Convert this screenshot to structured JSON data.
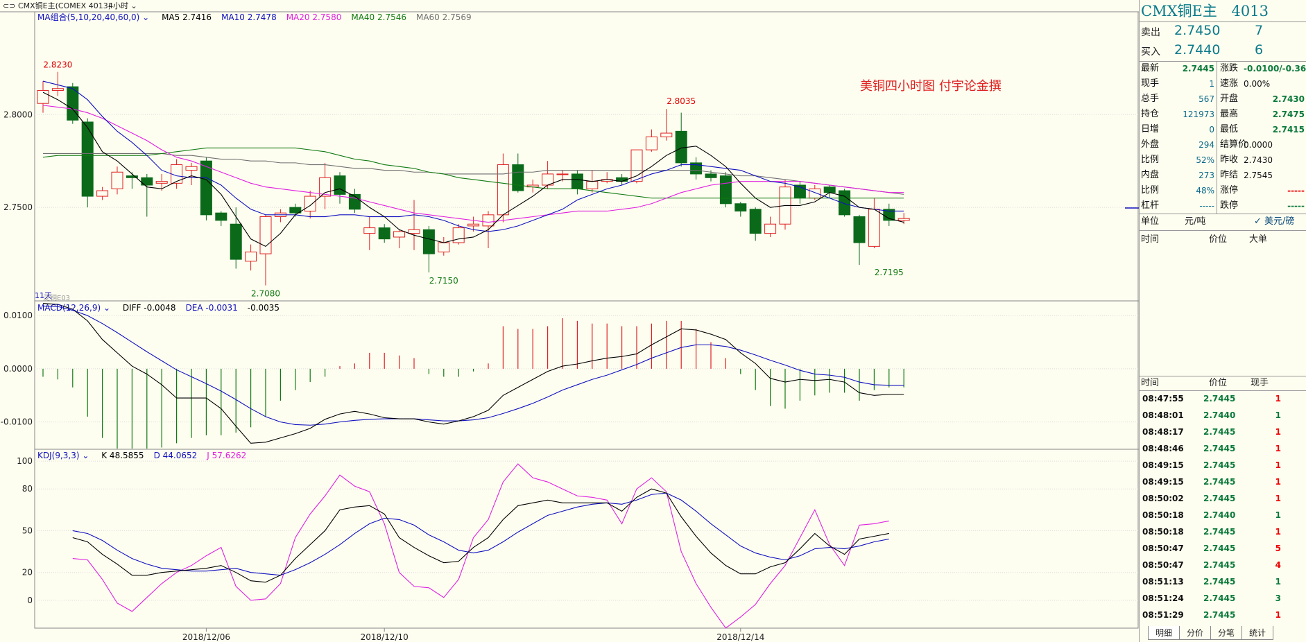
{
  "window": {
    "title": "CMX铜E主(COMEX 4013)",
    "period": "4小时"
  },
  "main_indicator": {
    "name": "MA组合(5,10,20,40,60,0)",
    "values": [
      {
        "label": "MA5 2.7416",
        "color": "#000000"
      },
      {
        "label": "MA10 2.7478",
        "color": "#1010c0"
      },
      {
        "label": "MA20 2.7580",
        "color": "#e020e0"
      },
      {
        "label": "MA40 2.7546",
        "color": "#107a10"
      },
      {
        "label": "MA60 2.7569",
        "color": "#707070"
      }
    ]
  },
  "annotation": "美铜四小时图  付宇论金撰",
  "sub_caption": "11天",
  "watermark": "泛铜E03",
  "macd_indicator": {
    "name": "MACD(12,26,9)",
    "values": [
      {
        "label": "DIFF -0.0048",
        "color": "#000000"
      },
      {
        "label": "DEA -0.0031",
        "color": "#1010c0"
      },
      {
        "label": "-0.0035",
        "color": "#000000"
      }
    ]
  },
  "kdj_indicator": {
    "name": "KDJ(9,3,3)",
    "values": [
      {
        "label": "K 48.5855",
        "color": "#000000"
      },
      {
        "label": "D 44.0652",
        "color": "#1010c0"
      },
      {
        "label": "J 57.6262",
        "color": "#e020e0"
      }
    ]
  },
  "chart_data": {
    "type": "candlestick",
    "price_axis": {
      "ticks": [
        "2.8000",
        "2.7500"
      ],
      "range": [
        2.7,
        2.855
      ]
    },
    "macd_axis": {
      "ticks": [
        "0.0100",
        "0.0000",
        "-0.0100"
      ],
      "range": [
        -0.015,
        0.0125
      ]
    },
    "kdj_axis": {
      "ticks": [
        "100",
        "80",
        "50",
        "20",
        "0"
      ],
      "range": [
        -20,
        108
      ]
    },
    "date_labels": [
      {
        "index": 11,
        "label": "2018/12/06"
      },
      {
        "index": 23,
        "label": "2018/12/10"
      },
      {
        "index": 47,
        "label": "2018/12/14"
      }
    ],
    "price_labels": [
      {
        "index": 1,
        "value": 2.823,
        "label": "2.8230",
        "color": "#e00000"
      },
      {
        "index": 15,
        "value": 2.708,
        "label": "2.7080",
        "color": "#107a10"
      },
      {
        "index": 27,
        "value": 2.715,
        "label": "2.7150",
        "color": "#107a10"
      },
      {
        "index": 43,
        "value": 2.8035,
        "label": "2.8035",
        "color": "#e00000"
      },
      {
        "index": 57,
        "value": 2.7195,
        "label": "2.7195",
        "color": "#107a10"
      }
    ],
    "candles": [
      [
        2.806,
        2.813,
        2.801,
        2.818
      ],
      [
        2.813,
        2.814,
        2.81,
        2.823
      ],
      [
        2.815,
        2.797,
        2.795,
        2.817
      ],
      [
        2.796,
        2.756,
        2.75,
        2.798
      ],
      [
        2.756,
        2.759,
        2.754,
        2.761
      ],
      [
        2.76,
        2.769,
        2.757,
        2.772
      ],
      [
        2.767,
        2.766,
        2.76,
        2.769
      ],
      [
        2.766,
        2.762,
        2.745,
        2.768
      ],
      [
        2.763,
        2.764,
        2.759,
        2.768
      ],
      [
        2.763,
        2.773,
        2.76,
        2.776
      ],
      [
        2.77,
        2.772,
        2.762,
        2.774
      ],
      [
        2.775,
        2.746,
        2.743,
        2.777
      ],
      [
        2.747,
        2.743,
        2.74,
        2.748
      ],
      [
        2.741,
        2.722,
        2.717,
        2.75
      ],
      [
        2.721,
        2.726,
        2.716,
        2.73
      ],
      [
        2.725,
        2.745,
        2.708,
        2.746
      ],
      [
        2.745,
        2.747,
        2.742,
        2.749
      ],
      [
        2.75,
        2.747,
        2.745,
        2.752
      ],
      [
        2.748,
        2.756,
        2.744,
        2.759
      ],
      [
        2.756,
        2.766,
        2.749,
        2.774
      ],
      [
        2.767,
        2.757,
        2.752,
        2.769
      ],
      [
        2.757,
        2.749,
        2.747,
        2.76
      ],
      [
        2.736,
        2.739,
        2.727,
        2.745
      ],
      [
        2.739,
        2.733,
        2.731,
        2.741
      ],
      [
        2.734,
        2.737,
        2.728,
        2.738
      ],
      [
        2.736,
        2.738,
        2.727,
        2.754
      ],
      [
        2.738,
        2.725,
        2.715,
        2.74
      ],
      [
        2.726,
        2.731,
        2.724,
        2.734
      ],
      [
        2.731,
        2.739,
        2.73,
        2.741
      ],
      [
        2.74,
        2.741,
        2.737,
        2.745
      ],
      [
        2.74,
        2.746,
        2.728,
        2.748
      ],
      [
        2.746,
        2.773,
        2.742,
        2.779
      ],
      [
        2.773,
        2.759,
        2.758,
        2.779
      ],
      [
        2.761,
        2.762,
        2.758,
        2.765
      ],
      [
        2.762,
        2.768,
        2.76,
        2.775
      ],
      [
        2.768,
        2.768,
        2.764,
        2.77
      ],
      [
        2.768,
        2.76,
        2.757,
        2.77
      ],
      [
        2.76,
        2.764,
        2.758,
        2.77
      ],
      [
        2.764,
        2.765,
        2.763,
        2.769
      ],
      [
        2.766,
        2.764,
        2.762,
        2.768
      ],
      [
        2.764,
        2.781,
        2.763,
        2.781
      ],
      [
        2.781,
        2.788,
        2.78,
        2.792
      ],
      [
        2.788,
        2.79,
        2.786,
        2.803
      ],
      [
        2.791,
        2.774,
        2.772,
        2.801
      ],
      [
        2.774,
        2.768,
        2.765,
        2.777
      ],
      [
        2.768,
        2.766,
        2.764,
        2.77
      ],
      [
        2.767,
        2.752,
        2.75,
        2.769
      ],
      [
        2.752,
        2.748,
        2.745,
        2.753
      ],
      [
        2.749,
        2.736,
        2.732,
        2.75
      ],
      [
        2.736,
        2.741,
        2.734,
        2.745
      ],
      [
        2.741,
        2.761,
        2.738,
        2.765
      ],
      [
        2.762,
        2.755,
        2.752,
        2.764
      ],
      [
        2.755,
        2.76,
        2.754,
        2.762
      ],
      [
        2.761,
        2.758,
        2.755,
        2.762
      ],
      [
        2.759,
        2.746,
        2.745,
        2.76
      ],
      [
        2.745,
        2.731,
        2.719,
        2.746
      ],
      [
        2.729,
        2.749,
        2.728,
        2.755
      ],
      [
        2.749,
        2.743,
        2.74,
        2.752
      ],
      [
        2.743,
        2.744,
        2.741,
        2.747
      ]
    ],
    "ma5": [
      2.812,
      2.808,
      2.803,
      2.793,
      2.78,
      2.775,
      2.768,
      2.761,
      2.76,
      2.764,
      2.767,
      2.765,
      2.757,
      2.745,
      2.733,
      2.729,
      2.736,
      2.746,
      2.751,
      2.758,
      2.76,
      2.756,
      2.75,
      2.745,
      2.738,
      2.735,
      2.733,
      2.731,
      2.733,
      2.734,
      2.738,
      2.746,
      2.751,
      2.756,
      2.762,
      2.765,
      2.765,
      2.764,
      2.765,
      2.764,
      2.767,
      2.772,
      2.778,
      2.782,
      2.783,
      2.778,
      2.772,
      2.763,
      2.755,
      2.75,
      2.751,
      2.751,
      2.753,
      2.758,
      2.756,
      2.75,
      2.749,
      2.744,
      2.742
    ],
    "ma10": [
      2.818,
      2.816,
      2.814,
      2.808,
      2.799,
      2.791,
      2.785,
      2.778,
      2.77,
      2.767,
      2.766,
      2.766,
      2.762,
      2.755,
      2.749,
      2.746,
      2.746,
      2.746,
      2.745,
      2.745,
      2.746,
      2.746,
      2.745,
      2.745,
      2.745,
      2.746,
      2.745,
      2.743,
      2.74,
      2.738,
      2.737,
      2.738,
      2.74,
      2.743,
      2.746,
      2.749,
      2.754,
      2.757,
      2.76,
      2.762,
      2.765,
      2.768,
      2.77,
      2.773,
      2.773,
      2.772,
      2.771,
      2.77,
      2.767,
      2.764,
      2.763,
      2.761,
      2.758,
      2.755,
      2.752,
      2.75,
      2.749,
      2.748,
      2.748
    ],
    "ma20": [
      2.805,
      2.804,
      2.803,
      2.801,
      2.798,
      2.794,
      2.79,
      2.786,
      2.781,
      2.777,
      2.775,
      2.772,
      2.769,
      2.766,
      2.763,
      2.761,
      2.76,
      2.759,
      2.758,
      2.757,
      2.756,
      2.755,
      2.753,
      2.751,
      2.749,
      2.747,
      2.746,
      2.745,
      2.744,
      2.743,
      2.742,
      2.743,
      2.744,
      2.745,
      2.746,
      2.747,
      2.748,
      2.748,
      2.748,
      2.749,
      2.75,
      2.752,
      2.755,
      2.758,
      2.76,
      2.762,
      2.763,
      2.764,
      2.764,
      2.764,
      2.764,
      2.764,
      2.763,
      2.762,
      2.761,
      2.76,
      2.759,
      2.758,
      2.758
    ],
    "ma40": [
      2.777,
      2.778,
      2.778,
      2.778,
      2.778,
      2.778,
      2.778,
      2.778,
      2.779,
      2.78,
      2.781,
      2.782,
      2.782,
      2.782,
      2.782,
      2.782,
      2.782,
      2.782,
      2.781,
      2.78,
      2.778,
      2.776,
      2.775,
      2.773,
      2.772,
      2.771,
      2.769,
      2.768,
      2.766,
      2.765,
      2.764,
      2.763,
      2.762,
      2.761,
      2.76,
      2.76,
      2.76,
      2.759,
      2.758,
      2.757,
      2.756,
      2.755,
      2.755,
      2.755,
      2.755,
      2.755,
      2.755,
      2.755,
      2.755,
      2.755,
      2.755,
      2.755,
      2.755,
      2.755,
      2.755,
      2.755,
      2.755,
      2.755,
      2.755
    ],
    "ma60": [
      2.779,
      2.779,
      2.779,
      2.779,
      2.779,
      2.779,
      2.779,
      2.779,
      2.779,
      2.778,
      2.778,
      2.777,
      2.776,
      2.776,
      2.775,
      2.775,
      2.774,
      2.774,
      2.773,
      2.773,
      2.772,
      2.771,
      2.771,
      2.77,
      2.77,
      2.769,
      2.769,
      2.768,
      2.768,
      2.768,
      2.768,
      2.768,
      2.769,
      2.769,
      2.77,
      2.77,
      2.77,
      2.77,
      2.77,
      2.77,
      2.77,
      2.77,
      2.77,
      2.77,
      2.77,
      2.769,
      2.768,
      2.767,
      2.767,
      2.766,
      2.765,
      2.764,
      2.763,
      2.762,
      2.761,
      2.76,
      2.759,
      2.758,
      2.757
    ],
    "macd_hist": [
      -0.0015,
      -0.002,
      -0.0035,
      -0.009,
      -0.013,
      -0.015,
      -0.015,
      -0.015,
      -0.0148,
      -0.014,
      -0.013,
      -0.0125,
      -0.0125,
      -0.012,
      -0.011,
      -0.009,
      -0.006,
      -0.004,
      -0.0025,
      -0.0015,
      0.0005,
      0.001,
      0.003,
      0.003,
      0.0025,
      0.002,
      -0.001,
      -0.0015,
      -0.0015,
      -0.0005,
      0.001,
      0.008,
      0.0075,
      0.0075,
      0.008,
      0.0095,
      0.009,
      0.0085,
      0.0085,
      0.008,
      0.008,
      0.0085,
      0.009,
      0.009,
      0.0075,
      0.005,
      0.002,
      -0.001,
      -0.004,
      -0.007,
      -0.0075,
      -0.006,
      -0.005,
      -0.0045,
      -0.0045,
      -0.006,
      -0.004,
      -0.0035,
      -0.0035
    ],
    "macd_diff": [
      0.0123,
      0.0121,
      0.0112,
      0.009,
      0.0055,
      0.003,
      0.0005,
      -0.001,
      -0.003,
      -0.0055,
      -0.0055,
      -0.0055,
      -0.0075,
      -0.0108,
      -0.014,
      -0.0138,
      -0.013,
      -0.0122,
      -0.0112,
      -0.0095,
      -0.0085,
      -0.008,
      -0.0085,
      -0.0092,
      -0.0094,
      -0.0094,
      -0.01,
      -0.0104,
      -0.0098,
      -0.009,
      -0.0078,
      -0.005,
      -0.0035,
      -0.002,
      -0.0005,
      0.0005,
      0.0009,
      0.0015,
      0.002,
      0.0023,
      0.0028,
      0.0045,
      0.006,
      0.0075,
      0.0073,
      0.0065,
      0.0055,
      0.003,
      0.001,
      -0.0018,
      -0.0025,
      -0.002,
      -0.0022,
      -0.002,
      -0.0025,
      -0.0045,
      -0.005,
      -0.0048,
      -0.0048
    ],
    "macd_dea": [
      0.0118,
      0.0117,
      0.011,
      0.01,
      0.0085,
      0.0068,
      0.005,
      0.0032,
      0.0015,
      -0.0002,
      -0.0015,
      -0.0028,
      -0.0042,
      -0.0058,
      -0.0075,
      -0.009,
      -0.01,
      -0.0105,
      -0.0106,
      -0.0104,
      -0.01,
      -0.0097,
      -0.0095,
      -0.0094,
      -0.0094,
      -0.0094,
      -0.0096,
      -0.0098,
      -0.0098,
      -0.0096,
      -0.0092,
      -0.0084,
      -0.0075,
      -0.0065,
      -0.0053,
      -0.004,
      -0.003,
      -0.002,
      -0.0012,
      -0.0002,
      0.0008,
      0.002,
      0.003,
      0.004,
      0.0045,
      0.0045,
      0.0042,
      0.0035,
      0.0026,
      0.0016,
      0.0007,
      -0.0003,
      -0.001,
      -0.0012,
      -0.0016,
      -0.0025,
      -0.003,
      -0.0031,
      -0.0031
    ],
    "kdj_k": [
      45,
      42,
      33,
      26,
      18,
      18,
      20,
      21,
      22,
      23,
      25,
      20,
      14,
      13,
      18,
      30,
      40,
      50,
      65,
      67,
      68,
      62,
      45,
      38,
      32,
      27,
      28,
      38,
      45,
      58,
      68,
      70,
      72,
      70,
      70,
      70,
      70,
      64,
      74,
      80,
      77,
      60,
      46,
      34,
      25,
      19,
      19,
      24,
      27,
      37,
      48,
      39,
      33,
      44,
      46,
      48
    ],
    "kdj_d": [
      50,
      48,
      43,
      36,
      30,
      26,
      23,
      22,
      21,
      21,
      22,
      23,
      20,
      19,
      18,
      22,
      27,
      33,
      40,
      48,
      55,
      59,
      58,
      54,
      47,
      42,
      36,
      34,
      36,
      42,
      49,
      55,
      61,
      64,
      67,
      69,
      70,
      69,
      72,
      76,
      77,
      72,
      64,
      55,
      47,
      39,
      34,
      31,
      29,
      32,
      37,
      38,
      37,
      39,
      42,
      44
    ],
    "kdj_j": [
      30,
      29,
      15,
      -2,
      -8,
      2,
      12,
      20,
      25,
      32,
      38,
      10,
      0,
      1,
      12,
      45,
      62,
      75,
      90,
      82,
      78,
      55,
      20,
      10,
      9,
      2,
      15,
      45,
      58,
      85,
      98,
      88,
      85,
      80,
      75,
      74,
      72,
      55,
      80,
      88,
      78,
      35,
      12,
      -5,
      -20,
      -12,
      -3,
      12,
      25,
      45,
      65,
      40,
      25,
      54,
      55,
      57
    ]
  },
  "panel": {
    "title": "CMX铜E主",
    "code": "4013",
    "quote": {
      "sell_label": "卖出",
      "sell_price": "2.7450",
      "sell_vol": "7",
      "buy_label": "买入",
      "buy_price": "2.7440",
      "buy_vol": "6"
    },
    "stats_left": [
      {
        "label": "最新",
        "value": "2.7445",
        "cls": "g"
      },
      {
        "label": "现手",
        "value": "1",
        "cls": "b"
      },
      {
        "label": "总手",
        "value": "567",
        "cls": "b"
      },
      {
        "label": "持仓",
        "value": "121973",
        "cls": "b"
      },
      {
        "label": "日增",
        "value": "0",
        "cls": "b"
      },
      {
        "label": "外盘",
        "value": "294",
        "cls": "b"
      },
      {
        "label": "比例",
        "value": "52%",
        "cls": "b"
      },
      {
        "label": "内盘",
        "value": "273",
        "cls": "b"
      },
      {
        "label": "比例",
        "value": "48%",
        "cls": "b"
      },
      {
        "label": "杠杆",
        "value": "-----",
        "cls": "b"
      }
    ],
    "stats_right": [
      {
        "label": "涨跌",
        "value": "-0.0100/-0.36%",
        "cls": "g"
      },
      {
        "label": "速涨",
        "value": "0.00%",
        "cls": "k"
      },
      {
        "label": "开盘",
        "value": "2.7430",
        "cls": "g"
      },
      {
        "label": "最高",
        "value": "2.7475",
        "cls": "g"
      },
      {
        "label": "最低",
        "value": "2.7415",
        "cls": "g"
      },
      {
        "label": "结算价",
        "value": "0.0000",
        "cls": "k"
      },
      {
        "label": "昨收",
        "value": "2.7430",
        "cls": "k"
      },
      {
        "label": "昨结",
        "value": "2.7545",
        "cls": "k"
      },
      {
        "label": "涨停",
        "value": "-----",
        "cls": "r"
      },
      {
        "label": "跌停",
        "value": "-----",
        "cls": "g"
      }
    ],
    "unit_label": "单位",
    "unit_value": "元/吨",
    "currency": "✓ 美元/磅",
    "big_headers": [
      "时间",
      "价位",
      "大单"
    ],
    "tick_headers": [
      "时间",
      "价位",
      "现手"
    ],
    "ticks": [
      {
        "time": "08:47:55",
        "price": "2.7445",
        "vol": "1",
        "vc": "r"
      },
      {
        "time": "08:48:01",
        "price": "2.7440",
        "vol": "1",
        "vc": "g"
      },
      {
        "time": "08:48:17",
        "price": "2.7445",
        "vol": "1",
        "vc": "r"
      },
      {
        "time": "08:48:46",
        "price": "2.7445",
        "vol": "1",
        "vc": "r"
      },
      {
        "time": "08:49:15",
        "price": "2.7445",
        "vol": "1",
        "vc": "r"
      },
      {
        "time": "08:49:15",
        "price": "2.7445",
        "vol": "1",
        "vc": "r"
      },
      {
        "time": "08:50:02",
        "price": "2.7445",
        "vol": "1",
        "vc": "r"
      },
      {
        "time": "08:50:18",
        "price": "2.7440",
        "vol": "1",
        "vc": "g"
      },
      {
        "time": "08:50:18",
        "price": "2.7445",
        "vol": "1",
        "vc": "r"
      },
      {
        "time": "08:50:47",
        "price": "2.7445",
        "vol": "5",
        "vc": "r"
      },
      {
        "time": "08:50:47",
        "price": "2.7445",
        "vol": "4",
        "vc": "r"
      },
      {
        "time": "08:51:13",
        "price": "2.7445",
        "vol": "1",
        "vc": "g"
      },
      {
        "time": "08:51:24",
        "price": "2.7445",
        "vol": "3",
        "vc": "g"
      },
      {
        "time": "08:51:29",
        "price": "2.7445",
        "vol": "1",
        "vc": "r"
      }
    ],
    "tabs": [
      "明细",
      "分价",
      "分笔",
      "统计"
    ]
  }
}
